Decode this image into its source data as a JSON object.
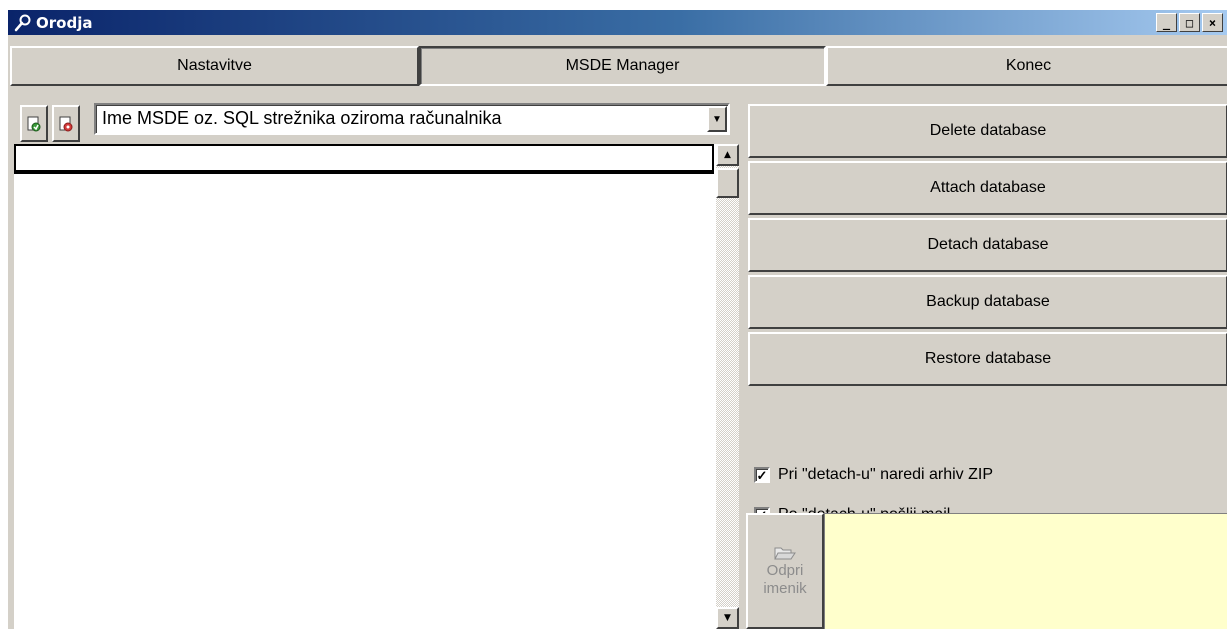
{
  "window": {
    "title": "Orodja",
    "icon": "wrench-icon",
    "controls": {
      "minimize": "_",
      "maximize": "□",
      "close": "×"
    }
  },
  "tabs": [
    {
      "label": "Nastavitve",
      "active": false
    },
    {
      "label": "MSDE Manager",
      "active": true
    },
    {
      "label": "Konec",
      "active": false
    }
  ],
  "left": {
    "tool_buttons": [
      {
        "icon": "connect-server-icon"
      },
      {
        "icon": "disconnect-server-icon"
      }
    ],
    "server_combo": {
      "value": "Ime MSDE oz. SQL strežnika oziroma računalnika",
      "icon": "dropdown-arrow-icon"
    },
    "database_list": []
  },
  "right": {
    "buttons": [
      "Delete database",
      "Attach database",
      "Detach database",
      "Backup database",
      "Restore database"
    ],
    "checkboxes": [
      {
        "label": "Pri \"detach-u\" naredi arhiv ZIP",
        "checked": true
      },
      {
        "label": "Po \"detach-u\" pošlji mail",
        "checked": true
      }
    ],
    "open_folder": {
      "line1": "Odpri",
      "line2": "imenik",
      "icon": "open-folder-icon",
      "disabled": true
    },
    "info_box_color": "#ffffcc"
  },
  "colors": {
    "title_bar_start": "#0a246a",
    "title_bar_end": "#a6caf0",
    "face": "#d4d0c8"
  }
}
